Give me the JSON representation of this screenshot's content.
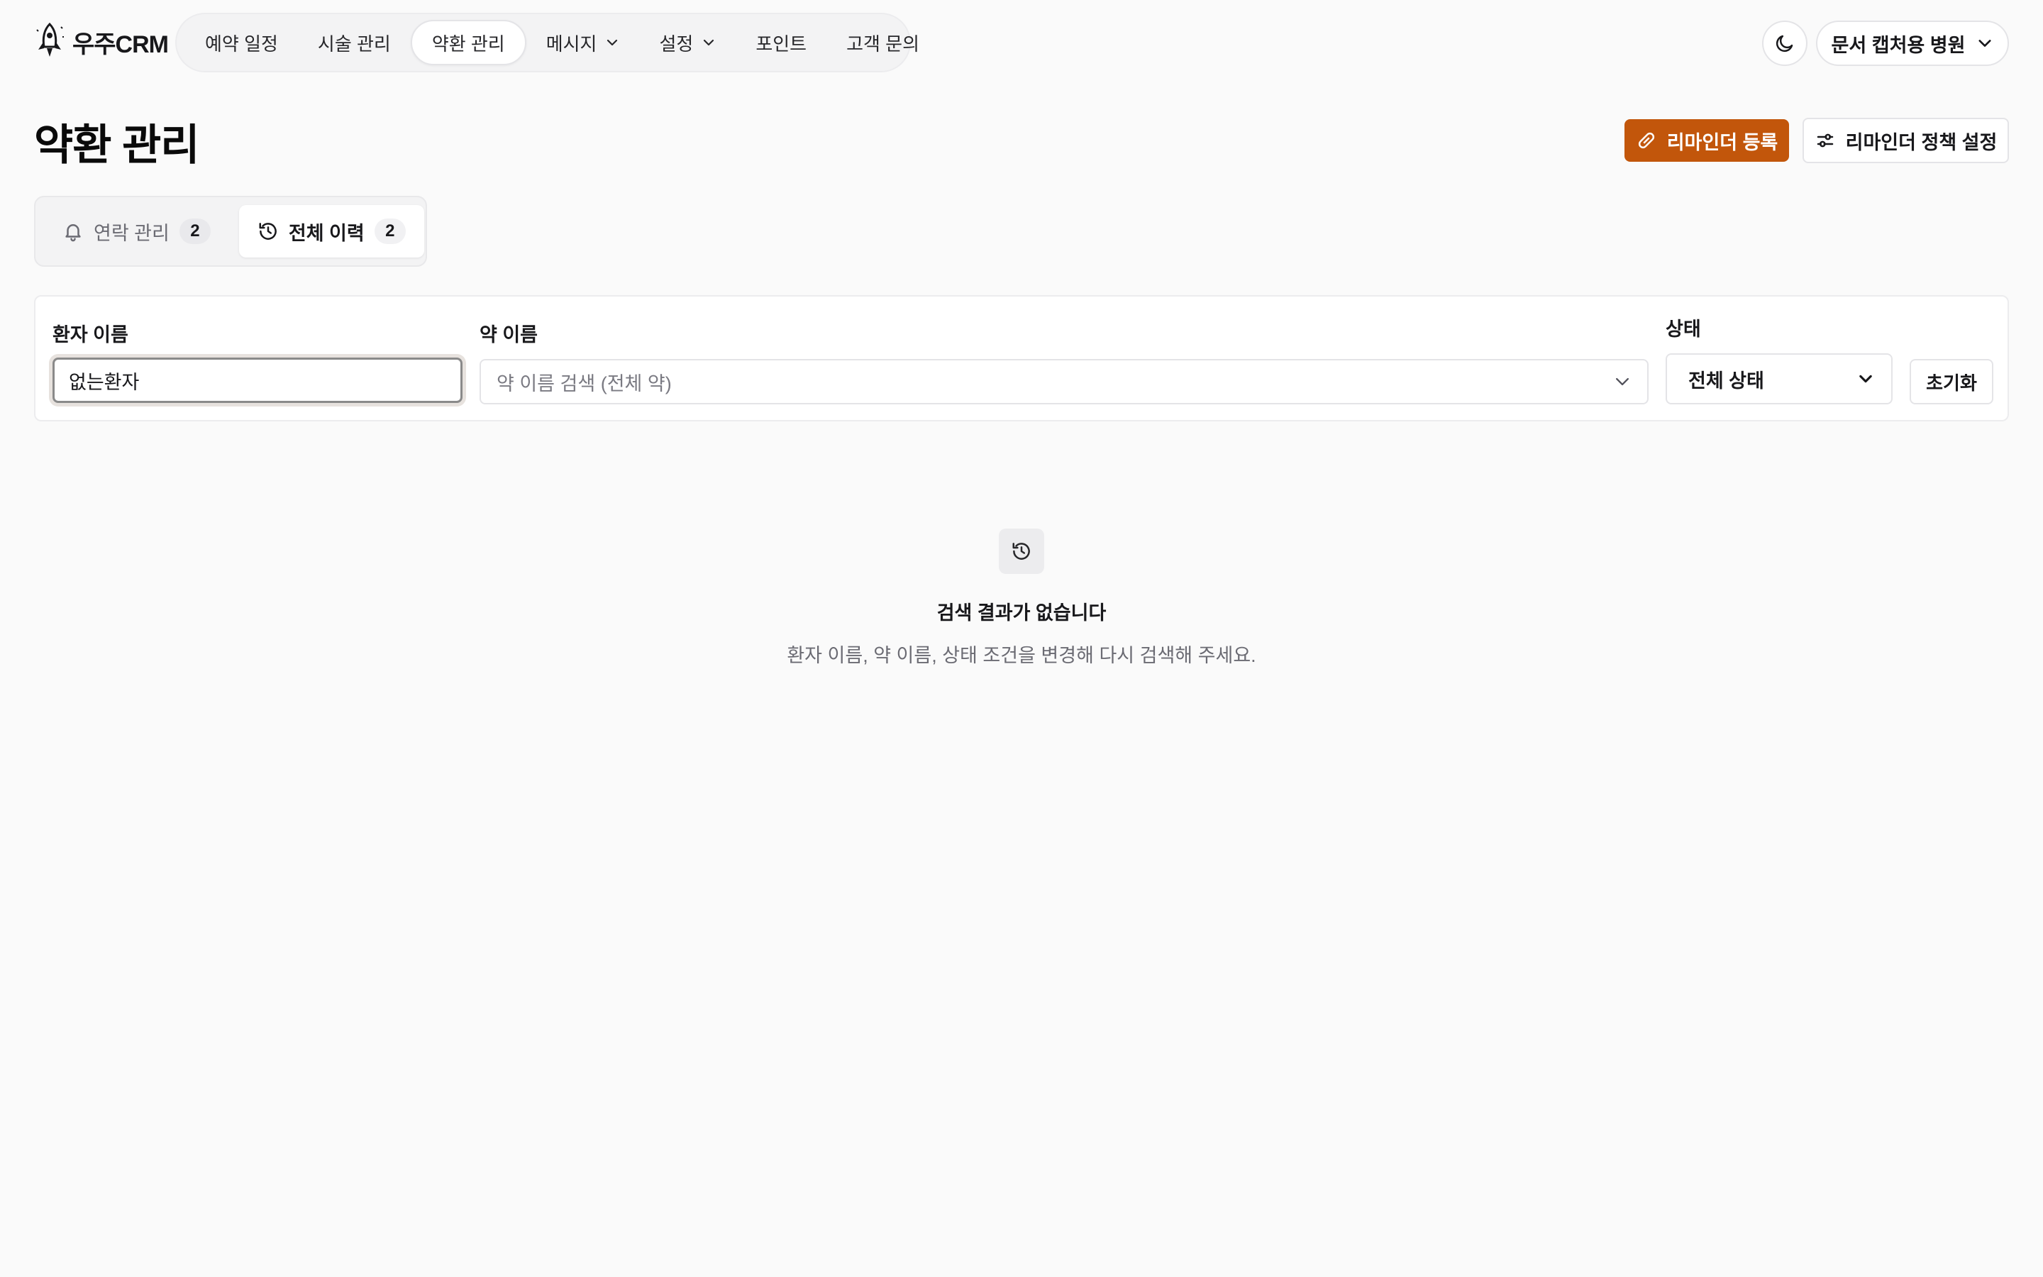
{
  "app": {
    "logo_text": "우주CRM"
  },
  "nav": {
    "items": [
      {
        "label": "예약 일정",
        "active": false,
        "dropdown": false
      },
      {
        "label": "시술 관리",
        "active": false,
        "dropdown": false
      },
      {
        "label": "약환 관리",
        "active": true,
        "dropdown": false
      },
      {
        "label": "메시지",
        "active": false,
        "dropdown": true
      },
      {
        "label": "설정",
        "active": false,
        "dropdown": true
      },
      {
        "label": "포인트",
        "active": false,
        "dropdown": false
      },
      {
        "label": "고객 문의",
        "active": false,
        "dropdown": false
      }
    ]
  },
  "header_right": {
    "theme_icon": "moon-icon",
    "hospital_label": "문서 캡처용 병원"
  },
  "page": {
    "title": "약환 관리",
    "primary_button": "리마인더 등록",
    "primary_icon": "pill-icon",
    "secondary_button": "리마인더 정책 설정",
    "secondary_icon": "settings-sliders-icon",
    "accent_color": "#c2560b"
  },
  "tabs": [
    {
      "label": "연락 관리",
      "count": "2",
      "icon": "bell-icon",
      "active": false
    },
    {
      "label": "전체 이력",
      "count": "2",
      "icon": "history-icon",
      "active": true
    }
  ],
  "filters": {
    "patient_label": "환자 이름",
    "patient_value": "없는환자",
    "drug_label": "약 이름",
    "drug_placeholder": "약 이름 검색 (전체 약)",
    "status_label": "상태",
    "status_value": "전체 상태",
    "reset_label": "초기화"
  },
  "empty_state": {
    "icon": "history-icon",
    "title": "검색 결과가 없습니다",
    "description": "환자 이름, 약 이름, 상태 조건을 변경해 다시 검색해 주세요."
  }
}
